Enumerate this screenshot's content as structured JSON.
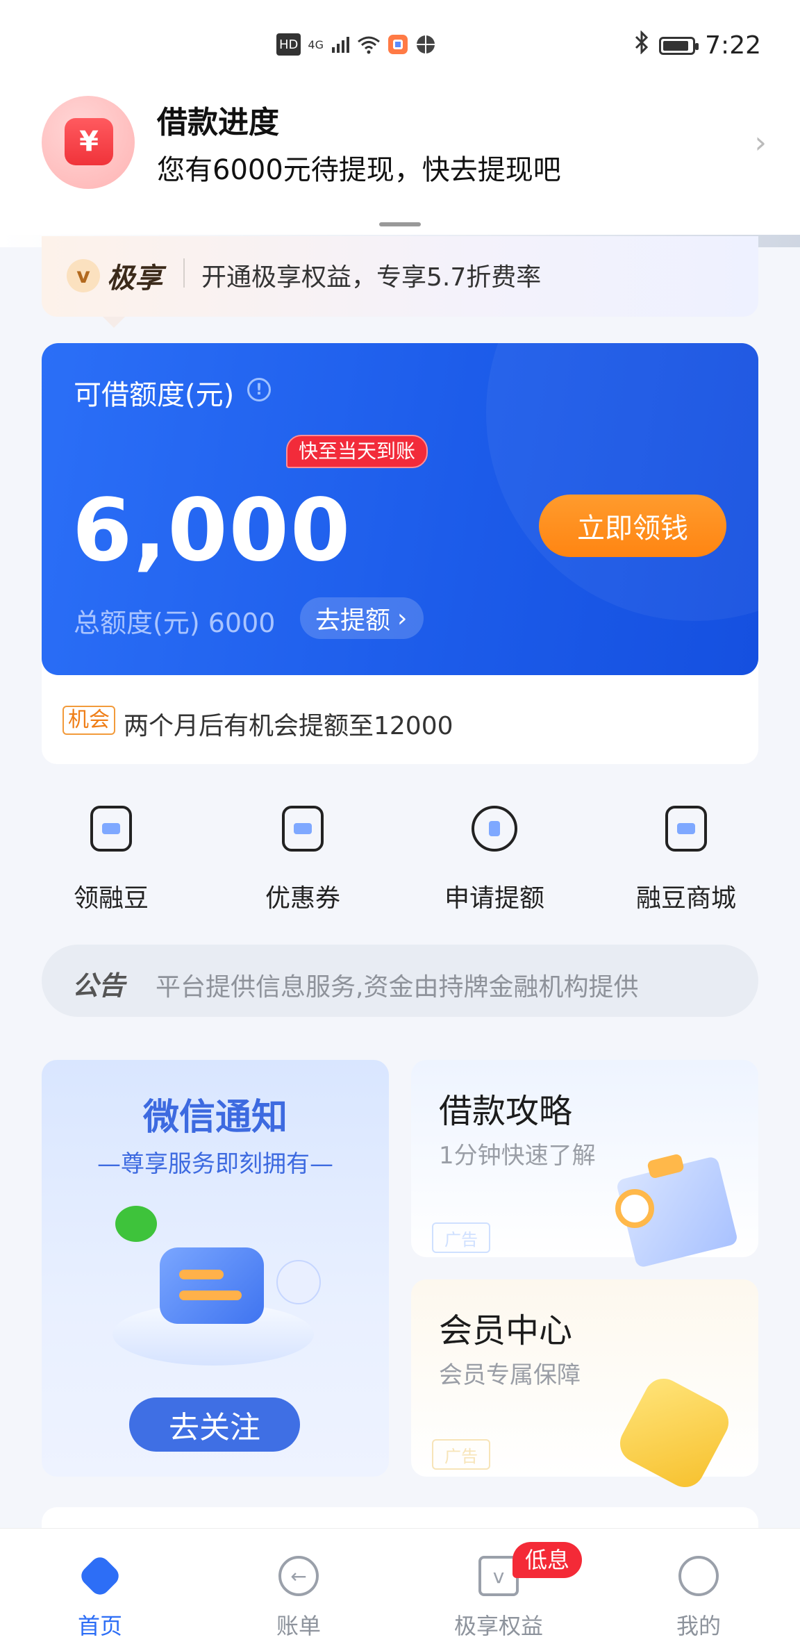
{
  "status_bar": {
    "time": "7:22",
    "icons": [
      "hd-icon",
      "signal-4g-icon",
      "wifi-icon",
      "app-icon",
      "basketball-icon",
      "bluetooth-icon",
      "battery-icon"
    ],
    "hd_text": "HD",
    "net_text": "4G"
  },
  "notification": {
    "title": "借款进度",
    "message": "您有6000元待提现，快去提现吧",
    "icon_text": "¥"
  },
  "jixiang": {
    "logo_v": "v",
    "logo_text": "极享",
    "text": "开通极享权益，专享5.7折费率"
  },
  "quota": {
    "label": "可借额度(元)",
    "info_icon": "!",
    "badge": "快至当天到账",
    "amount": "6,000",
    "cta": "立即领钱",
    "total_label": "总额度(元) 6000",
    "raise_label": "去提额",
    "tip_tag": "机会",
    "tip_text": "两个月后有机会提额至12000"
  },
  "actions": [
    {
      "label": "领融豆",
      "icon": "bean-coupon-icon"
    },
    {
      "label": "优惠券",
      "icon": "coupon-icon"
    },
    {
      "label": "申请提额",
      "icon": "raise-limit-icon"
    },
    {
      "label": "融豆商城",
      "icon": "shopping-bag-icon"
    }
  ],
  "notice": {
    "tag": "公告",
    "text": "平台提供信息服务,资金由持牌金融机构提供"
  },
  "promos": {
    "wechat": {
      "title": "微信通知",
      "subtitle": "—尊享服务即刻拥有—",
      "button": "去关注"
    },
    "guide": {
      "title": "借款攻略",
      "subtitle": "1分钟快速了解",
      "ad": "广告"
    },
    "member": {
      "title": "会员中心",
      "subtitle": "会员专属保障",
      "ad": "广告"
    }
  },
  "tabs": [
    {
      "label": "首页",
      "icon": "home-icon",
      "active": true
    },
    {
      "label": "账单",
      "icon": "bill-icon",
      "active": false
    },
    {
      "label": "极享权益",
      "icon": "crown-icon",
      "active": false
    },
    {
      "label": "我的",
      "icon": "profile-icon",
      "active": false
    }
  ],
  "tab_badge": "低息",
  "colors": {
    "brand_blue": "#1c5be9",
    "cta_orange": "#ff8512",
    "badge_red": "#f22b3a"
  }
}
